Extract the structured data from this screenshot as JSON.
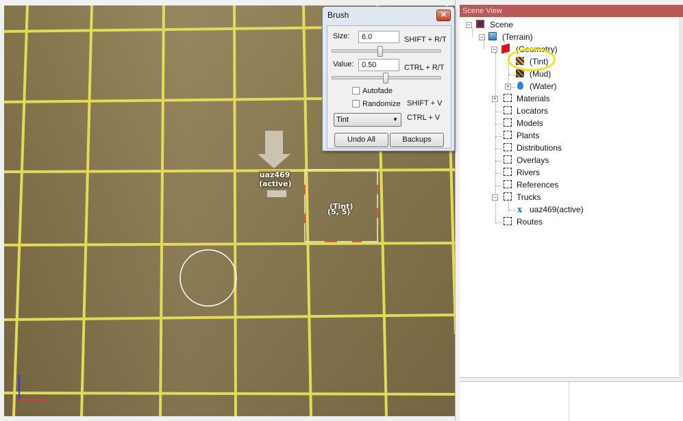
{
  "viewport": {
    "vehicle_label_line1": "uaz469",
    "vehicle_label_line2": "(active)",
    "cell_label": "(Tint)",
    "cell_coords": "(5, 5)",
    "grid_color": "#e8e05a",
    "terrain_color": "#8c7b52"
  },
  "brush": {
    "title": "Brush",
    "close_icon": "close-icon",
    "size_label": "Size:",
    "size_value": "6.0",
    "size_hint": "SHIFT + R/T",
    "size_slider": 0.45,
    "value_label": "Value:",
    "value_value": "0.50",
    "value_hint": "CTRL + R/T",
    "value_slider": 0.5,
    "autofade_label": "Autofade",
    "autofade_checked": false,
    "randomize_label": "Randomize",
    "randomize_checked": false,
    "randomize_hint": "SHIFT + V",
    "mode_selected": "Tint",
    "mode_hint": "CTRL + V",
    "undo_all_label": "Undo All",
    "backups_label": "Backups"
  },
  "scene_view": {
    "header": "Scene View",
    "items": [
      {
        "label": "Scene",
        "icon": "scene-icon"
      },
      {
        "label": "(Terrain)",
        "icon": "terrain-icon"
      },
      {
        "label": "(Geometry)",
        "icon": "geometry-icon"
      },
      {
        "label": "(Tint)",
        "icon": "tint-icon"
      },
      {
        "label": "(Mud)",
        "icon": "mud-icon"
      },
      {
        "label": "(Water)",
        "icon": "water-icon"
      },
      {
        "label": "Materials",
        "icon": "folder-icon"
      },
      {
        "label": "Locators",
        "icon": "folder-icon"
      },
      {
        "label": "Models",
        "icon": "folder-icon"
      },
      {
        "label": "Plants",
        "icon": "folder-icon"
      },
      {
        "label": "Distributions",
        "icon": "folder-icon"
      },
      {
        "label": "Overlays",
        "icon": "folder-icon"
      },
      {
        "label": "Rivers",
        "icon": "folder-icon"
      },
      {
        "label": "References",
        "icon": "folder-icon"
      },
      {
        "label": "Trucks",
        "icon": "folder-icon"
      },
      {
        "label": "uaz469(active)",
        "icon": "truck-icon"
      },
      {
        "label": "Routes",
        "icon": "folder-icon"
      }
    ],
    "highlight_color": "#f1e317"
  }
}
